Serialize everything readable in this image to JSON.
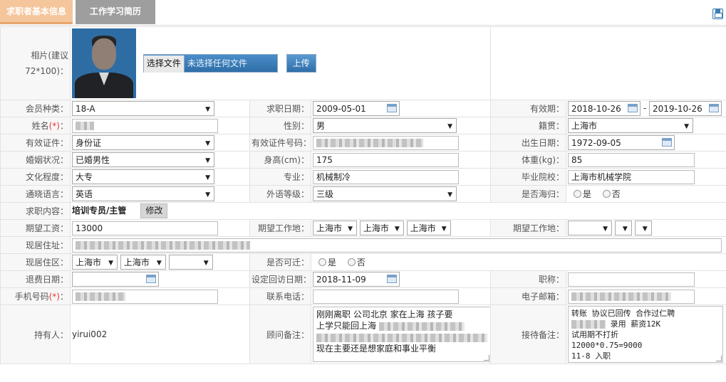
{
  "tabs": [
    {
      "label": "求职者基本信息",
      "active": true
    },
    {
      "label": "工作学习简历",
      "active": false
    }
  ],
  "photo": {
    "label": "相片(建议72*100)：",
    "file_button": "选择文件",
    "file_status": "未选择任何文件",
    "upload_button": "上传"
  },
  "member_type": {
    "label": "会员种类：",
    "value": "18-A"
  },
  "job_date": {
    "label": "求职日期：",
    "value": "2009-05-01"
  },
  "validity": {
    "label": "有效期：",
    "from": "2018-10-26",
    "sep": "-",
    "to": "2019-10-26"
  },
  "name": {
    "label": "姓名",
    "req": "(*)",
    "colon": "："
  },
  "gender": {
    "label": "性别：",
    "value": "男"
  },
  "native": {
    "label": "籍贯：",
    "value": "上海市"
  },
  "id_type": {
    "label": "有效证件：",
    "value": "身份证"
  },
  "id_number": {
    "label": "有效证件号码："
  },
  "birth_date": {
    "label": "出生日期：",
    "value": "1972-09-05"
  },
  "marital": {
    "label": "婚姻状况：",
    "value": "已婚男性"
  },
  "height": {
    "label": "身高(cm)：",
    "value": "175"
  },
  "weight": {
    "label": "体重(kg)：",
    "value": "85"
  },
  "education": {
    "label": "文化程度：",
    "value": "大专"
  },
  "major": {
    "label": "专业：",
    "value": "机械制冷"
  },
  "school": {
    "label": "毕业院校：",
    "value": "上海市机械学院"
  },
  "language": {
    "label": "通晓语言：",
    "value": "英语"
  },
  "lang_level": {
    "label": "外语等级：",
    "value": "三级"
  },
  "overseas": {
    "label": "是否海归：",
    "yes": "是",
    "no": "否"
  },
  "job_content": {
    "label": "求职内容：",
    "value": "培训专员/主管",
    "edit_button": "修改"
  },
  "salary": {
    "label": "期望工资：",
    "value": "13000"
  },
  "work_place": {
    "label": "期望工作地：",
    "province": "上海市",
    "city": "上海市",
    "district": "上海市"
  },
  "work_place2": {
    "label": "期望工作地："
  },
  "address": {
    "label": "现居住址："
  },
  "residence": {
    "label": "现居住区：",
    "province": "上海市",
    "city": "上海市"
  },
  "relocate": {
    "label": "是否可迁：",
    "yes": "是",
    "no": "否"
  },
  "retire_date": {
    "label": "退费日期："
  },
  "visit_date": {
    "label": "设定回访日期：",
    "value": "2018-11-09"
  },
  "title": {
    "label": "职称："
  },
  "mobile": {
    "label": "手机号码",
    "req": "(*)",
    "colon": "："
  },
  "phone": {
    "label": "联系电话："
  },
  "email": {
    "label": "电子邮箱："
  },
  "holder": {
    "label": "持有人：",
    "value": "yirui002"
  },
  "consultant_note": {
    "label": "顾问备注：",
    "line1": "刚刚离职  公司北京 家在上海  孩子要",
    "line2": "上学只能回上海",
    "line3": "现在主要还是想家庭和事业平衡"
  },
  "reception_note": {
    "label": "接待备注：",
    "line1": "转账 协议已回传 合作过仁聘",
    "line2b": "录用 薪资12K",
    "line3": "试用期不打折",
    "line4": "12000*0.75=9000",
    "line5": "11-8 入职"
  },
  "colors": {
    "tab_active": "#f5c59b",
    "tab_inactive": "#9e9e9e",
    "button_blue": "#2f6ea8",
    "required": "#e33333"
  }
}
